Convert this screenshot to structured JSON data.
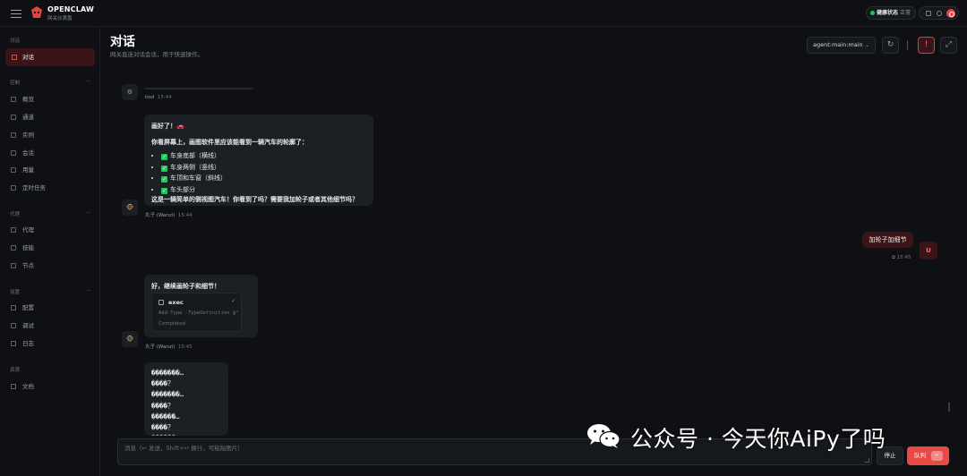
{
  "app": {
    "brand": "OPENCLAW",
    "brand_sub": "网关仪表盘",
    "health_label": "健康状态",
    "health_value": "正常",
    "accent": "#e84b45",
    "health_color": "#22c55e"
  },
  "sidebar": {
    "sections": [
      {
        "label": "对话",
        "items": [
          {
            "label": "对话",
            "icon": "chat-icon",
            "active": true
          }
        ]
      },
      {
        "label": "控制",
        "items": [
          {
            "label": "概览",
            "icon": "chart-icon"
          },
          {
            "label": "通道",
            "icon": "link-icon"
          },
          {
            "label": "实例",
            "icon": "signal-icon"
          },
          {
            "label": "会话",
            "icon": "document-icon"
          },
          {
            "label": "用量",
            "icon": "usage-icon"
          },
          {
            "label": "定时任务",
            "icon": "clock-icon"
          }
        ]
      },
      {
        "label": "代理",
        "items": [
          {
            "label": "代理",
            "icon": "folder-icon"
          },
          {
            "label": "技能",
            "icon": "sparkle-icon"
          },
          {
            "label": "节点",
            "icon": "monitor-icon"
          }
        ]
      },
      {
        "label": "设置",
        "items": [
          {
            "label": "配置",
            "icon": "gear-icon"
          },
          {
            "label": "调试",
            "icon": "bug-icon"
          },
          {
            "label": "日志",
            "icon": "log-icon"
          }
        ]
      },
      {
        "label": "资源",
        "items": [
          {
            "label": "文档",
            "icon": "book-icon"
          }
        ]
      }
    ]
  },
  "header": {
    "title": "对话",
    "subtitle": "网关直连对话会话，用于快速操作。",
    "agent_select": "agent:main:main"
  },
  "messages": {
    "tool": {
      "sender": "tool",
      "time": "15:44"
    },
    "m1": {
      "heading": "画好了！🚗",
      "intro": "你看屏幕上，画图软件里应该能看到一辆汽车的轮廓了：",
      "items": [
        "车身底部（横线）",
        "车身两侧（竖线）",
        "车顶和车窗（斜线）",
        "车头部分"
      ],
      "outro": "这是一辆简单的侧视图汽车！你看到了吗？需要我加轮子或者其他细节吗？",
      "sender": "丸子 (Wanzi)",
      "time": "15:44"
    },
    "user": {
      "text": "加轮子加细节",
      "avatar": "U",
      "time": "15:45"
    },
    "m2": {
      "text": "好，继续画轮子和细节！",
      "exec_name": "exec",
      "exec_cmd": "Add-Type -TypeDefinition @\"",
      "exec_status": "Completed",
      "sender": "丸子 (Wanzi)",
      "time": "15:45"
    },
    "m3": {
      "lines": [
        "�������…",
        "����？",
        "�������…",
        "����？",
        "������…",
        "����？",
        "������…"
      ]
    }
  },
  "composer": {
    "placeholder": "消息（↩ 发送，Shift+↩ 换行，可粘贴图片）",
    "stop_label": "停止",
    "queue_label": "队列",
    "queue_kbd": "↩"
  },
  "watermark": {
    "text": "公众号 · 今天你AiPy了吗"
  }
}
